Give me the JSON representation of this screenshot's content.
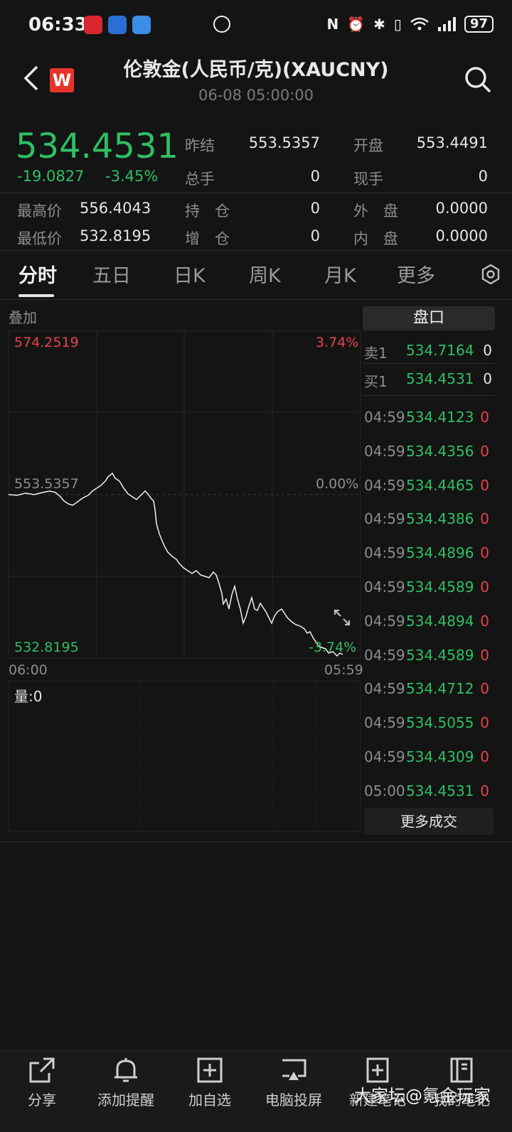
{
  "status": {
    "time": "06:33",
    "battery": "97",
    "nfc": "N"
  },
  "header": {
    "logo_letter": "W",
    "title": "伦敦金(人民币/克)(XAUCNY)",
    "timestamp": "06-08 05:00:00"
  },
  "quote": {
    "price": "534.4531",
    "change": "-19.0827",
    "change_pct": "-3.45%",
    "prev_settle_label": "昨结",
    "prev_settle": "553.5357",
    "open_label": "开盘",
    "open": "553.4491",
    "total_vol_label": "总手",
    "total_vol": "0",
    "cur_vol_label": "现手",
    "cur_vol": "0",
    "high_label": "最高价",
    "high": "556.4043",
    "low_label": "最低价",
    "low": "532.8195",
    "oi_label": "持　仓",
    "oi": "0",
    "oi_chg_label": "增　仓",
    "oi_chg": "0",
    "outer_label": "外　盘",
    "outer": "0.0000",
    "inner_label": "内　盘",
    "inner": "0.0000"
  },
  "tabs": [
    "分时",
    "五日",
    "日K",
    "周K",
    "月K",
    "更多"
  ],
  "chart": {
    "overlay_label": "叠加",
    "y_top": "574.2519",
    "y_top_pct": "3.74%",
    "y_mid": "553.5357",
    "y_mid_pct": "0.00%",
    "y_bottom": "532.8195",
    "y_bottom_pct": "-3.74%",
    "x_start": "06:00",
    "x_end": "05:59",
    "volume_label": "量:0"
  },
  "orderbook": {
    "title": "盘口",
    "sell1_label": "卖1",
    "sell1_price": "534.7164",
    "sell1_vol": "0",
    "buy1_label": "买1",
    "buy1_price": "534.4531",
    "buy1_vol": "0",
    "trades": [
      {
        "time": "04:59",
        "price": "534.4123",
        "vol": "0"
      },
      {
        "time": "04:59",
        "price": "534.4356",
        "vol": "0"
      },
      {
        "time": "04:59",
        "price": "534.4465",
        "vol": "0"
      },
      {
        "time": "04:59",
        "price": "534.4386",
        "vol": "0"
      },
      {
        "time": "04:59",
        "price": "534.4896",
        "vol": "0"
      },
      {
        "time": "04:59",
        "price": "534.4589",
        "vol": "0"
      },
      {
        "time": "04:59",
        "price": "534.4894",
        "vol": "0"
      },
      {
        "time": "04:59",
        "price": "534.4589",
        "vol": "0"
      },
      {
        "time": "04:59",
        "price": "534.4712",
        "vol": "0"
      },
      {
        "time": "04:59",
        "price": "534.5055",
        "vol": "0"
      },
      {
        "time": "04:59",
        "price": "534.4309",
        "vol": "0"
      },
      {
        "time": "05:00",
        "price": "534.4531",
        "vol": "0"
      }
    ],
    "more_label": "更多成交"
  },
  "bottom_nav": [
    "分享",
    "添加提醒",
    "加自选",
    "电脑投屏",
    "新建笔记",
    "我的笔记"
  ],
  "watermark": "大家坛@氪金玩家",
  "colors": {
    "up": "#e8424a",
    "down": "#2fbf63",
    "background": "#141414"
  }
}
